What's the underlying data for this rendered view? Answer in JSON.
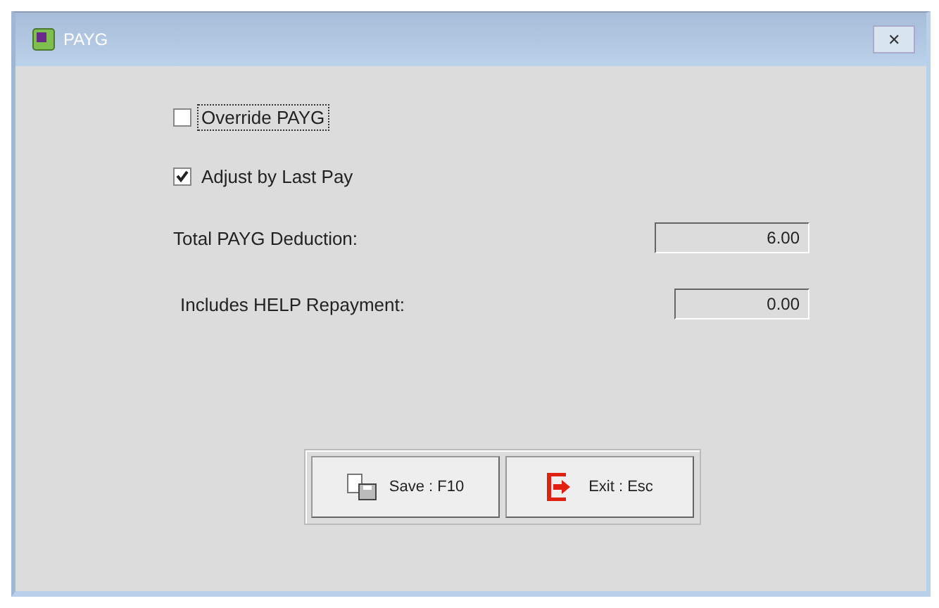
{
  "window": {
    "title": "PAYG",
    "close": "✕"
  },
  "options": [
    {
      "label": "Override PAYG",
      "checked": false,
      "focused": true
    },
    {
      "label": "Adjust by Last Pay",
      "checked": true,
      "focused": false
    }
  ],
  "fields": [
    {
      "label": "Total PAYG Deduction:",
      "value": "6.00"
    },
    {
      "label": "Includes HELP Repayment:",
      "value": "0.00"
    }
  ],
  "buttons": [
    {
      "kind": "save",
      "label": "Save : F10"
    },
    {
      "kind": "exit",
      "label": "Exit : Esc"
    }
  ]
}
